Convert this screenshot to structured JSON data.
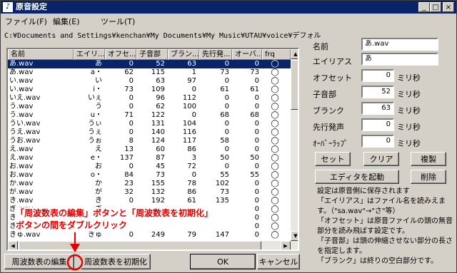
{
  "window": {
    "title": "原音設定",
    "controls": [
      "_",
      "□",
      "×"
    ]
  },
  "menu": [
    "ファイル(F)",
    "編集(E)",
    "ツール(T)"
  ],
  "path": "C:¥Documents and Settings¥kenchan¥My Documents¥My Music¥UTAU¥voice¥デフォル",
  "table": {
    "headers": [
      "名前",
      "エイリ...",
      "オフセ...",
      "子音部",
      "ブラン...",
      "先行発...",
      "オーバ...",
      "frq"
    ],
    "rows": [
      [
        "あ.wav",
        "あ",
        "0",
        "52",
        "63",
        "0",
        "0",
        "◯"
      ],
      [
        "あ.wav",
        "a・",
        "62",
        "115",
        "1",
        "73",
        "73",
        "◯"
      ],
      [
        "い.wav",
        "い",
        "0",
        "63",
        "97",
        "0",
        "0",
        "◯"
      ],
      [
        "い.wav",
        "i・",
        "73",
        "109",
        "0",
        "61",
        "61",
        "◯"
      ],
      [
        "いえ.wav",
        "いぇ",
        "0",
        "96",
        "112",
        "0",
        "0",
        "◯"
      ],
      [
        "う.wav",
        "う",
        "0",
        "62",
        "100",
        "0",
        "0",
        "◯"
      ],
      [
        "う.wav",
        "u・",
        "71",
        "122",
        "0",
        "68",
        "68",
        "◯"
      ],
      [
        "うい.wav",
        "うぃ",
        "0",
        "131",
        "104",
        "0",
        "0",
        "◯"
      ],
      [
        "うえ.wav",
        "うぇ",
        "0",
        "140",
        "116",
        "0",
        "0",
        "◯"
      ],
      [
        "うお.wav",
        "うぉ",
        "8",
        "124",
        "117",
        "58",
        "0",
        "◯"
      ],
      [
        "え.wav",
        "え",
        "13",
        "60",
        "86",
        "0",
        "0",
        "◯"
      ],
      [
        "え.wav",
        "e・",
        "137",
        "87",
        "3",
        "50",
        "50",
        "◯"
      ],
      [
        "お.wav",
        "お",
        "0",
        "45",
        "72",
        "0",
        "0",
        "◯"
      ],
      [
        "お.wav",
        "o・",
        "84",
        "73",
        "0",
        "55",
        "55",
        "◯"
      ],
      [
        "か.wav",
        "か",
        "23",
        "155",
        "78",
        "102",
        "0",
        "◯"
      ],
      [
        "が.wav",
        "が",
        "32",
        "132",
        "86",
        "73",
        "0",
        "◯"
      ],
      [
        "き.wav",
        "き",
        "0",
        "192",
        "61",
        "135",
        "0",
        "◯"
      ],
      [
        "ぎ.wav",
        "ぎ",
        "",
        "",
        "",
        "",
        "0",
        "◯"
      ],
      [
        "きゃ.wav",
        "きゃ",
        "",
        "",
        "",
        "",
        "0",
        "◯"
      ],
      [
        "きゅ.wav",
        "きゅ",
        "",
        "",
        "",
        "",
        "0",
        "◯"
      ],
      [
        "きゅ.wav",
        "きゅ",
        "0",
        "249",
        "79",
        "147",
        "0",
        "◯"
      ]
    ]
  },
  "details": {
    "name_label": "名前",
    "name_value": "あ.wav",
    "alias_label": "エイリアス",
    "alias_value": "あ",
    "offset_label": "オフセット",
    "offset_value": "0",
    "offset_unit": "ミリ秒",
    "consonant_label": "子音部",
    "consonant_value": "52",
    "consonant_unit": "ミリ秒",
    "blank_label": "ブランク",
    "blank_value": "63",
    "blank_unit": "ミリ秒",
    "preutter_label": "先行発声",
    "preutter_value": "0",
    "preutter_unit": "ミリ秒",
    "overlap_label": "ｵｰﾊﾞｰﾗｯﾌﾟ",
    "overlap_value": "0",
    "overlap_unit": "ミリ秒"
  },
  "buttons": {
    "set": "セット",
    "clear": "クリア",
    "copy": "複製",
    "editor": "エディタを起動",
    "delete": "削除",
    "freq_edit": "周波数表の編集",
    "freq_init": "周波数表を初期化",
    "ok": "OK",
    "cancel": "キャンセル"
  },
  "notes": {
    "n1": "設定は原音側に保存されます",
    "n2": "「エイリアス」はファイル名を読みえます。（\"sa.wav\"→\"さ\"等）",
    "n3": "「オフセット」は原音ファイルの頭の無音部分を読み飛ばす設定です。",
    "n4": "「子音部」は頭の伸縮させない部分の長さを指定します。",
    "n5": "「ブランク」は終りの空白部分です。"
  },
  "annotation": {
    "line1": "「周波数表の編集」ボタンと「周波数表を初期化」",
    "line2": "ボタンの間をダブルクリック",
    "color": "#e00000"
  }
}
